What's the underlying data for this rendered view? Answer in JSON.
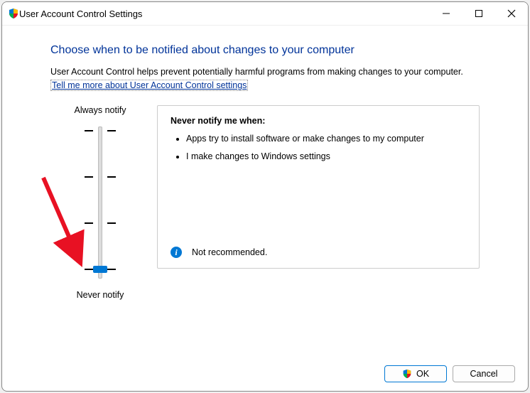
{
  "titlebar": {
    "title": "User Account Control Settings"
  },
  "heading": "Choose when to be notified about changes to your computer",
  "description": "User Account Control helps prevent potentially harmful programs from making changes to your computer.",
  "help_link": "Tell me more about User Account Control settings",
  "slider": {
    "top_label": "Always notify",
    "bottom_label": "Never notify"
  },
  "info": {
    "title": "Never notify me when:",
    "bullets": [
      "Apps try to install software or make changes to my computer",
      "I make changes to Windows settings"
    ],
    "recommendation": "Not recommended."
  },
  "buttons": {
    "ok": "OK",
    "cancel": "Cancel"
  }
}
